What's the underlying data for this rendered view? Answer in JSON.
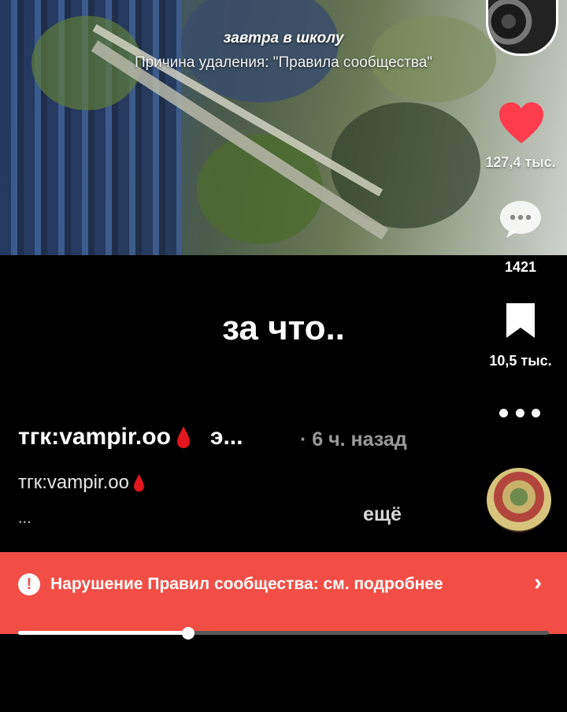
{
  "video": {
    "title": "завтра в школу",
    "reason": "Причина удаления: \"Правила сообщества\""
  },
  "rail": {
    "likes": "127,4 тыс.",
    "comments": "1421",
    "saves": "10,5 тыс.",
    "heart_color": "#ff3b4e"
  },
  "post": {
    "center_text": "за что..",
    "author": "тгк:vampir.oo",
    "author_suffix": "э...",
    "time": "· 6 ч. назад",
    "description": "тгк:vampir.oo",
    "ellipsis": "...",
    "more_label": "ещё"
  },
  "banner": {
    "text": "Нарушение Правил сообщества: см. подробнее",
    "color": "#f24e46"
  },
  "progress": {
    "fraction": 0.32
  }
}
